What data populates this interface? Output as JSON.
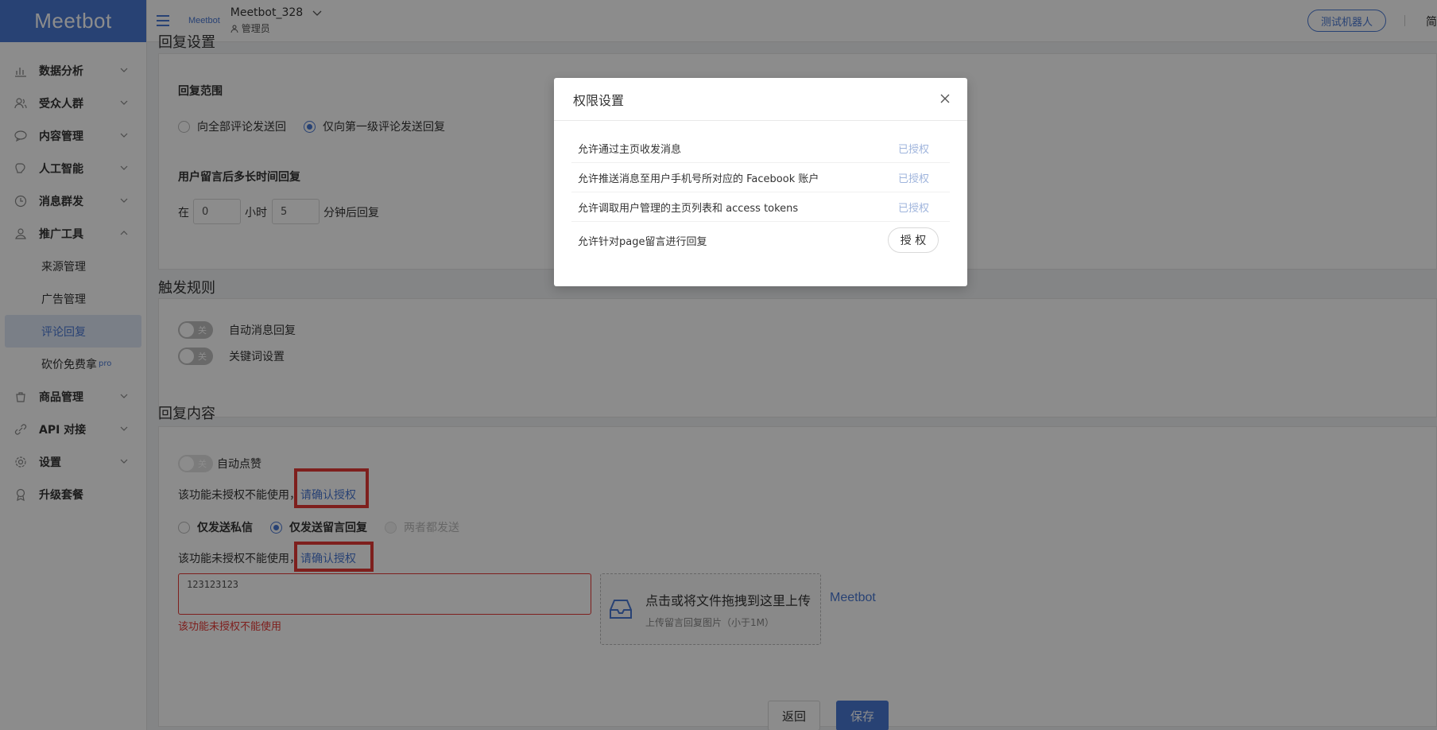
{
  "brand": {
    "name": "Meetbot",
    "small_logo": "Meetbot",
    "accent": "#4a78d4"
  },
  "header": {
    "account_name": "Meetbot_328",
    "role": "管理员",
    "test_bot_label": "测试机器人",
    "lang": "简"
  },
  "sidebar": {
    "items": [
      {
        "label": "数据分析",
        "icon": "chart-icon"
      },
      {
        "label": "受众人群",
        "icon": "users-icon"
      },
      {
        "label": "内容管理",
        "icon": "chat-icon"
      },
      {
        "label": "人工智能",
        "icon": "brain-icon"
      },
      {
        "label": "消息群发",
        "icon": "clock-icon"
      },
      {
        "label": "推广工具",
        "icon": "promo-icon"
      }
    ],
    "promo_sub": [
      {
        "label": "来源管理"
      },
      {
        "label": "广告管理"
      },
      {
        "label": "评论回复",
        "active": true
      },
      {
        "label": "砍价免费拿",
        "badge": "pro"
      }
    ],
    "items_after": [
      {
        "label": "商品管理",
        "icon": "goods-icon"
      },
      {
        "label": "API 对接",
        "icon": "api-icon"
      },
      {
        "label": "设置",
        "icon": "gear-icon"
      },
      {
        "label": "升级套餐",
        "icon": "upgrade-icon"
      }
    ]
  },
  "reply_settings": {
    "title": "回复设置",
    "scope_label": "回复范围",
    "scope_options": [
      "向全部评论发送回",
      "仅向第一级评论发送回复"
    ],
    "scope_selected": 1,
    "delay_label": "用户留言后多长时间回复",
    "delay_prefix": "在",
    "hours": "0",
    "hours_unit": "小时",
    "minutes": "5",
    "minutes_suffix": "分钟后回复"
  },
  "trigger_rules": {
    "title": "触发规则",
    "toggle_off_text": "关",
    "auto_reply_label": "自动消息回复",
    "keyword_label": "关键词设置"
  },
  "reply_content": {
    "title": "回复内容",
    "auto_like_label": "自动点赞",
    "notice_text": "该功能未授权不能使用，",
    "notice_link": "请确认授权",
    "send_options": [
      "仅发送私信",
      "仅发送留言回复",
      "两者都发送"
    ],
    "send_selected": 1,
    "textarea_value": "123123123",
    "error_text": "该功能未授权不能使用",
    "upload_main": "点击或将文件拖拽到这里上传",
    "upload_sub": "上传留言回复图片（小于1M）",
    "side_logo": "Meetbot"
  },
  "footer": {
    "back_label": "返回",
    "save_label": "保存"
  },
  "modal": {
    "title": "权限设置",
    "permissions": [
      {
        "label": "允许通过主页收发消息",
        "status": "已授权"
      },
      {
        "label": "允许推送消息至用户手机号所对应的 Facebook 账户",
        "status": "已授权"
      },
      {
        "label": "允许调取用户管理的主页列表和 access tokens",
        "status": "已授权"
      },
      {
        "label": "允许针对page留言进行回复",
        "button": "授 权"
      }
    ]
  }
}
